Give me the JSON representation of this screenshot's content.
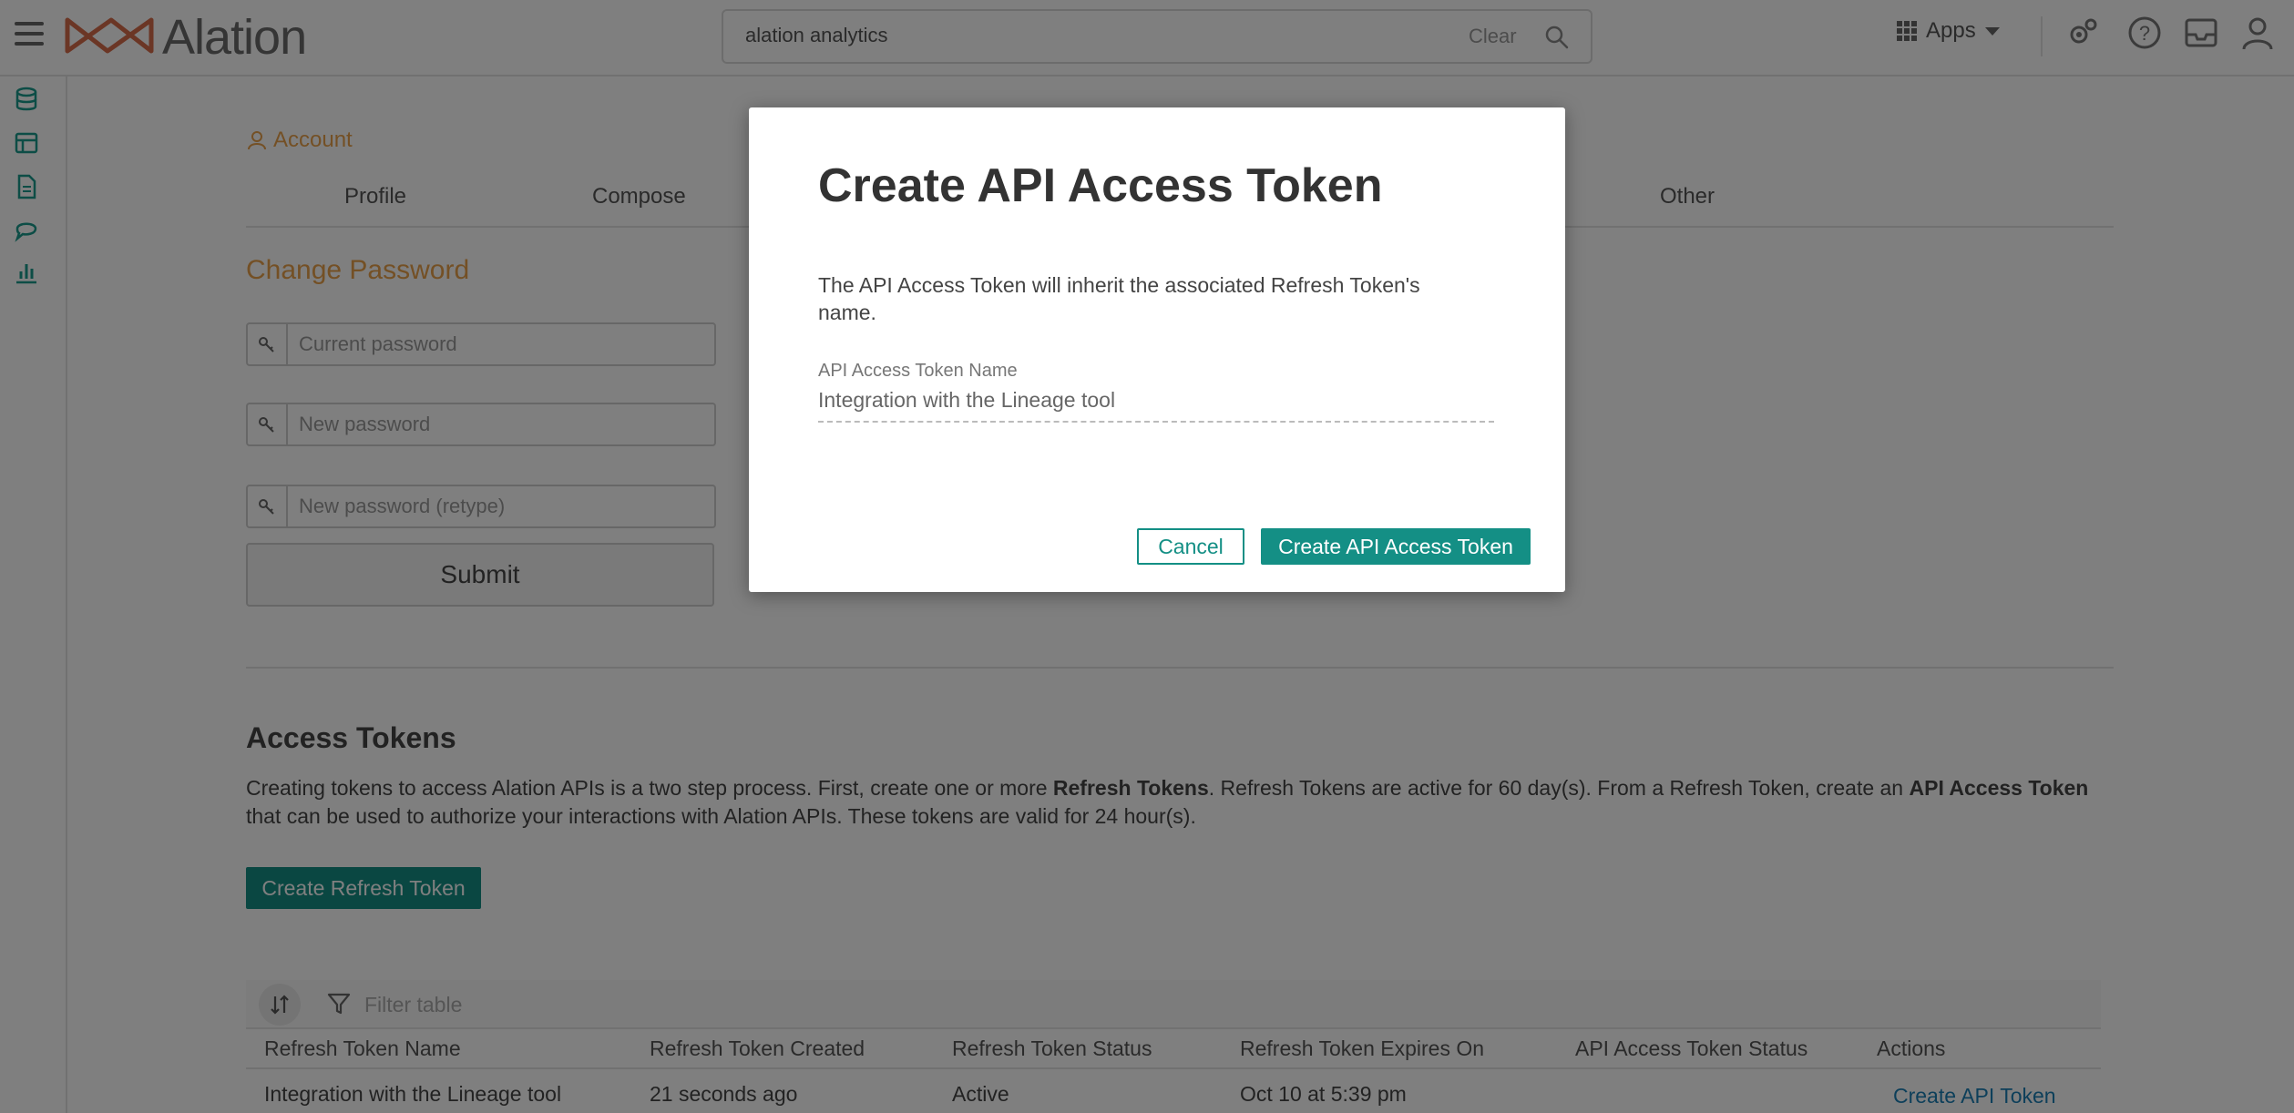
{
  "header": {
    "brand": "Alation",
    "search": {
      "value": "alation analytics",
      "clear_label": "Clear"
    },
    "apps_label": "Apps"
  },
  "account": {
    "breadcrumb": "Account",
    "tabs": [
      "Profile",
      "Compose",
      "Other"
    ],
    "change_password": {
      "title": "Change Password",
      "fields": [
        "Current password",
        "New password",
        "New password (retype)"
      ],
      "submit_label": "Submit"
    }
  },
  "access_tokens": {
    "title": "Access Tokens",
    "desc_1": "Creating tokens to access Alation APIs is a two step process. First, create one or more ",
    "desc_bold_1": "Refresh Tokens",
    "desc_2": ". Refresh Tokens are active for 60 day(s). From a Refresh Token, create an ",
    "desc_bold_2": "API Access Token",
    "desc_3": " that can be used to authorize your interactions with Alation APIs. These tokens are valid for 24 hour(s).",
    "create_refresh_label": "Create Refresh Token",
    "filter_placeholder": "Filter table",
    "columns": [
      "Refresh Token Name",
      "Refresh Token Created",
      "Refresh Token Status",
      "Refresh Token Expires On",
      "API Access Token Status",
      "Actions"
    ],
    "rows": [
      {
        "name": "Integration with the Lineage tool",
        "created": "21 seconds ago",
        "status": "Active",
        "expires": "Oct 10 at 5:39 pm",
        "api_status": "",
        "action": "Create API Token"
      }
    ]
  },
  "modal": {
    "title": "Create API Access Token",
    "text": "The API Access Token will inherit the associated Refresh Token's name.",
    "field_label": "API Access Token Name",
    "field_value": "Integration with the Lineage tool",
    "cancel_label": "Cancel",
    "create_label": "Create API Access Token"
  },
  "colors": {
    "accent": "#148f85",
    "orange": "#e8a14a",
    "link": "#1a7fb5"
  }
}
